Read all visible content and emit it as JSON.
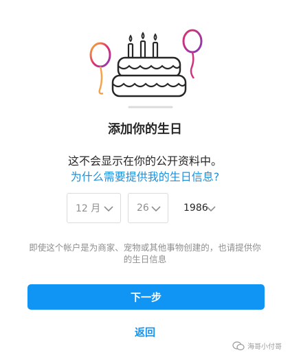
{
  "dialog": {
    "title": "添加你的生日",
    "subtitle": "这不会显示在你的公开资料中。",
    "why_link": "为什么需要提供我的生日信息?",
    "birthday": {
      "month": "12 月",
      "day": "26",
      "year": "1986"
    },
    "note": "即使这个帐户是为商家、宠物或其他事物创建的，也请提供你的生日信息",
    "next_label": "下一步",
    "back_label": "返回"
  },
  "watermark": {
    "text": "海哥小付哥"
  },
  "icons": {
    "illustration": "birthday-cake-balloons-icon",
    "select_arrow": "chevron-down-icon",
    "watermark": "wechat-icon"
  },
  "colors": {
    "primary": "#1095f4",
    "link": "#1d90d9",
    "text": "#262626",
    "muted": "#8e8e8e",
    "border": "#dbdbdb"
  }
}
